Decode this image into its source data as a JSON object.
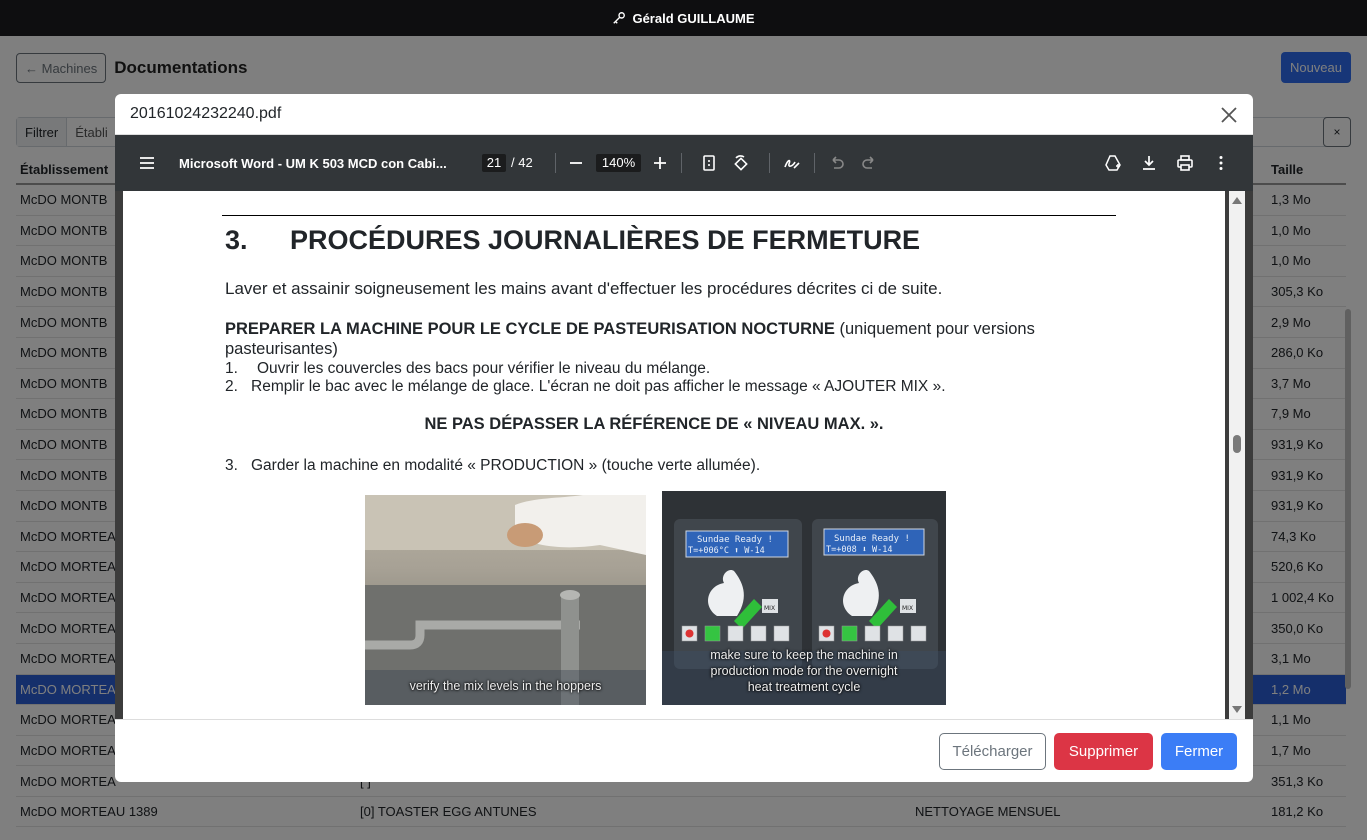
{
  "topbar": {
    "user": "Gérald GUILLAUME",
    "icon": "key-icon"
  },
  "header": {
    "back_label": "← Machines",
    "title": "Documentations",
    "new_label": "Nouveau"
  },
  "filter": {
    "label": "Filtrer",
    "chip": "Établi",
    "clear": "×"
  },
  "table": {
    "headers": {
      "establishment": "Établissement",
      "size": "Taille"
    },
    "sizes": [
      "1,3 Mo",
      "1,0 Mo",
      "1,0 Mo",
      "305,3 Ko",
      "2,9 Mo",
      "286,0 Ko",
      "3,7 Mo",
      "7,9 Mo",
      "931,9 Ko",
      "931,9 Ko",
      "931,9 Ko",
      "74,3 Ko",
      "520,6 Ko",
      "1 002,4 Ko",
      "350,0 Ko",
      "3,1 Mo",
      "1,2 Mo",
      "1,1 Mo",
      "1,7 Mo",
      "351,3 Ko",
      "181,2 Ko"
    ],
    "establishments": [
      "McDO MONTB",
      "McDO MONTB",
      "McDO MONTB",
      "McDO MONTB",
      "McDO MONTB",
      "McDO MONTB",
      "McDO MONTB",
      "McDO MONTB",
      "McDO MONTB",
      "McDO MONTB",
      "McDO MONTB",
      "McDO MORTEA",
      "McDO MORTEA",
      "McDO MORTEA",
      "McDO MORTEA",
      "McDO MORTEA",
      "McDO MORTEA",
      "McDO MORTEA",
      "McDO MORTEA",
      "McDO MORTEA",
      "McDO MORTEAU 1389"
    ],
    "selected_index": 16,
    "last_row": {
      "machine": "[0] TOASTER EGG ANTUNES",
      "category": "NETTOYAGE MENSUEL"
    },
    "row_20_fragment": "[ ]"
  },
  "modal": {
    "filename": "20161024232240.pdf",
    "viewer": {
      "doc_title": "Microsoft Word - UM K 503 MCD con Cabi...",
      "page": "21",
      "total": "/ 42",
      "zoom": "140%"
    },
    "page": {
      "section_number": "3.",
      "section_title": "PROCÉDURES JOURNALIÈRES DE FERMETURE",
      "intro": "Laver et assainir soigneusement les mains avant d'effectuer les procédures décrites ci de suite.",
      "prep_bold": "PREPARER LA MACHINE POUR LE CYCLE DE PASTEURISATION NOCTURNE",
      "prep_rest": " (uniquement pour versions pasteurisantes)",
      "item1_num": "1.",
      "item1": "Ouvrir les couvercles des bacs pour vérifier le niveau du mélange.",
      "item2_num": "2.",
      "item2": "Remplir le bac avec le mélange de glace. L'écran ne doit pas afficher le message « AJOUTER MIX ».",
      "warning": "NE PAS DÉPASSER LA RÉFÉRENCE DE « NIVEAU MAX. ».",
      "item3_num": "3.",
      "item3": "Garder la machine en modalité « PRODUCTION » (touche verte allumée).",
      "photo1_caption": "verify the mix levels in the hoppers",
      "photo2_caption": "make sure to keep the machine in production mode for the overnight heat treatment cycle",
      "lcd_line1": "Sundae Ready !",
      "lcd_left_line2": "T=+006°C ⬆ W-14",
      "lcd_right_line2": "T=+008   ⬇  W-14",
      "mix_label": "MIX"
    },
    "footer": {
      "download": "Télécharger",
      "delete": "Supprimer",
      "close": "Fermer"
    }
  }
}
